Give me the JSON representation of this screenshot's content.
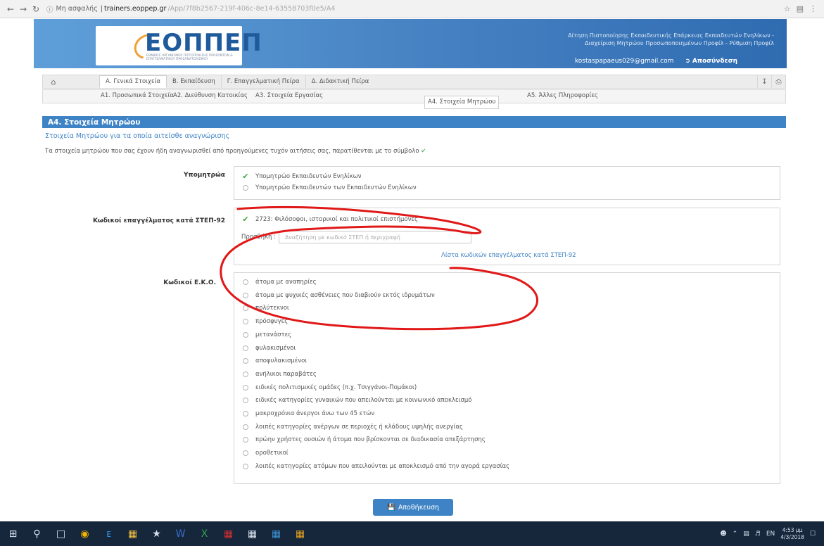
{
  "browser": {
    "security": "Μη ασφαλής",
    "host": "trainers.eoppep.gr",
    "path": "/App/7f8b2567-219f-406c-8e14-63558703f0e5/A4"
  },
  "header": {
    "logo": "ΕΟΠΠΕΠ",
    "logo_sub": "ΕΘΝΙΚΟΣ ΟΡΓΑΝΙΣΜΟΣ ΠΙΣΤΟΠΟΙΗΣΗΣ ΠΡΟΣΟΝΤΩΝ & ΕΠΑΓΓΕΛΜΑΤΙΚΟΥ ΠΡΟΣΑΝΑΤΟΛΙΣΜΟΥ",
    "title_line1": "Αίτηση Πιστοποίησης Εκπαιδευτικής Επάρκειας Εκπαιδευτών Ενηλίκων -",
    "title_line2": "Διαχείριση Μητρώου Προσωποποιημένων Προφίλ - Ρύθμιση Προφίλ",
    "email": "kostaspapaeus029@gmail.com",
    "logout": "Αποσύνδεση"
  },
  "tabs": [
    "Α. Γενικά Στοιχεία",
    "Β. Εκπαίδευση",
    "Γ. Επαγγελματική Πείρα",
    "Δ. Διδακτική Πείρα"
  ],
  "subtabs": [
    "Α1. Προσωπικά Στοιχεία",
    "Α2. Διεύθυνση Κατοικίας",
    "Α3. Στοιχεία Εργασίας",
    "Α4. Στοιχεία Μητρώου",
    "Α5. Άλλες Πληροφορίες"
  ],
  "section": {
    "title": "Α4. Στοιχεία Μητρώου",
    "subtitle": "Στοιχεία Μητρώου για τα οποία αιτείσθε αναγνώρισης",
    "info": "Τα στοιχεία μητρώου που σας έχουν ήδη αναγνωρισθεί από προηγούμενες τυχόν αιτήσεις σας, παρατίθενται με το σύμβολο"
  },
  "submitroa": {
    "label": "Υπομητρώα",
    "options": [
      "Υπομητρώο Εκπαιδευτών Ενηλίκων",
      "Υπομητρώο Εκπαιδευτών των Εκπαιδευτών Ενηλίκων"
    ]
  },
  "steps": {
    "label": "Κωδικοί επαγγέλματος κατά ΣΤΕΠ-92",
    "selected": "2723: Φιλόσοφοι, ιστορικοί και πολιτικοί επιστήμονες",
    "add_label": "Προσθήκη :",
    "placeholder": "Αναζήτηση με κωδικό ΣΤΕΠ ή περιγραφή",
    "link": "Λίστα κωδικών επαγγέλματος κατά ΣΤΕΠ-92"
  },
  "eko": {
    "label": "Κωδικοί Ε.Κ.Ο.",
    "options": [
      "άτομα με αναπηρίες",
      "άτομα με ψυχικές ασθένειες που διαβιούν εκτός ιδρυμάτων",
      "πολύτεκνοι",
      "πρόσφυγες",
      "μετανάστες",
      "φυλακισμένοι",
      "αποφυλακισμένοι",
      "ανήλικοι παραβάτες",
      "ειδικές πολιτισμικές ομάδες (π.χ. Τσιγγάνοι-Πομάκοι)",
      "ειδικές κατηγορίες γυναικών που απειλούνται με κοινωνικό αποκλεισμό",
      "μακροχρόνια άνεργοι άνω των 45 ετών",
      "λοιπές κατηγορίες ανέργων σε περιοχές ή κλάδους υψηλής ανεργίας",
      "πρώην χρήστες ουσιών ή άτομα που βρίσκονται σε διαδικασία απεξάρτησης",
      "οροθετικοί",
      "λοιπές κατηγορίες ατόμων που απειλούνται με αποκλεισμό από την αγορά εργασίας"
    ]
  },
  "save_label": "Αποθήκευση",
  "taskbar": {
    "lang": "EN",
    "time": "4:53 μμ",
    "date": "4/3/2018"
  },
  "colors": {
    "accent": "#3d83c5",
    "check": "#3aa83a",
    "annotation": "#e01818"
  }
}
